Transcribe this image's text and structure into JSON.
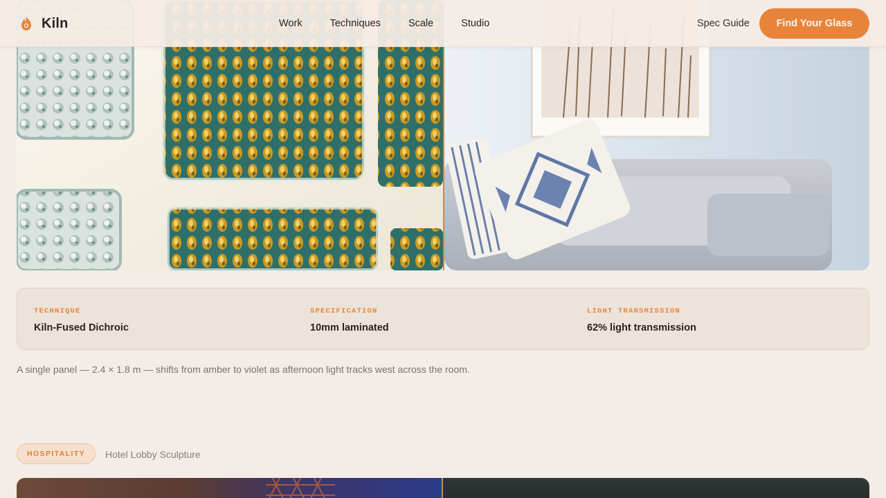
{
  "brand": {
    "name": "Kiln",
    "logo_icon": "kiln-flame-icon",
    "accent_color": "#e8843a"
  },
  "nav": {
    "items": [
      {
        "label": "Work"
      },
      {
        "label": "Techniques"
      },
      {
        "label": "Scale"
      },
      {
        "label": "Studio"
      }
    ],
    "spec_link": "Spec Guide",
    "cta_label": "Find Your Glass"
  },
  "project": {
    "images": [
      {
        "subject": "dichroic-glass-panel"
      },
      {
        "subject": "living-room-sofa"
      }
    ],
    "specs": [
      {
        "label": "Technique",
        "value": "Kiln-Fused Dichroic"
      },
      {
        "label": "Specification",
        "value": "10mm laminated"
      },
      {
        "label": "Light Transmission",
        "value": "62% light transmission"
      }
    ],
    "caption": "A single panel — 2.4 × 1.8 m — shifts from amber to violet as afternoon light tracks west across the room."
  },
  "next_project": {
    "tag": "Hospitality",
    "title": "Hotel Lobby Sculpture"
  }
}
